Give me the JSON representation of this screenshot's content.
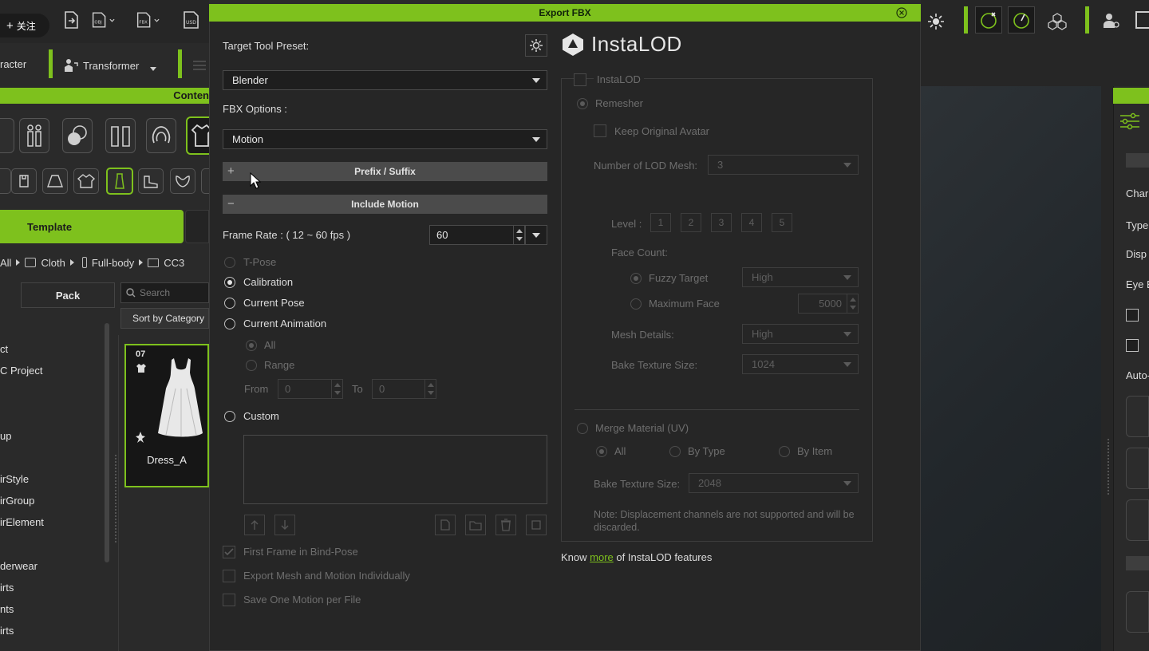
{
  "app": {
    "follow_label": "关注",
    "topbar_icons": [
      "import-icon",
      "obj-export-icon",
      "fbx-export-icon",
      "usd-export-icon"
    ],
    "character_label": "racter",
    "transformer_label": "Transformer",
    "content_label": "Conten",
    "template_tab": "Template",
    "breadcrumb": {
      "all": "All",
      "cloth": "Cloth",
      "fullbody": "Full-body",
      "cc3": "CC3"
    },
    "pack_tab": "Pack",
    "search_placeholder": "Search",
    "sort_label": "Sort by Category",
    "tree_items": [
      "ct",
      "C Project",
      "up",
      "irStyle",
      "irGroup",
      "irElement",
      "derwear",
      "irts",
      "nts",
      "irts"
    ],
    "thumbnail": {
      "badge": "07",
      "name": "Dress_A"
    },
    "right_panel_labels": [
      "Char",
      "Type",
      "Disp",
      "Eye E",
      "Auto-"
    ]
  },
  "dialog": {
    "title": "Export FBX",
    "target_tool_preset_label": "Target Tool Preset:",
    "target_tool_preset_value": "Blender",
    "fbx_options_label": "FBX Options :",
    "fbx_options_value": "Motion",
    "prefix_suffix": {
      "symbol": "+",
      "label": "Prefix / Suffix"
    },
    "include_motion": {
      "symbol": "−",
      "label": "Include Motion"
    },
    "frame_rate_label": "Frame Rate : ( 12 ~ 60 fps )",
    "frame_rate_value": "60",
    "pose_options": {
      "tpose": "T-Pose",
      "calibration": "Calibration",
      "current_pose": "Current Pose",
      "current_animation": "Current Animation",
      "all": "All",
      "range": "Range",
      "from_label": "From",
      "from_value": "0",
      "to_label": "To",
      "to_value": "0",
      "custom": "Custom"
    },
    "selected_pose": "Calibration",
    "checkboxes": {
      "first_frame_bind_pose": "First Frame in Bind-Pose",
      "export_mesh_motion": "Export Mesh and Motion Individually",
      "save_one_motion": "Save One Motion per File"
    },
    "instalod": {
      "logo_text": "InstaLOD",
      "group_label": "InstaLOD",
      "remesher": "Remesher",
      "keep_original": "Keep Original Avatar",
      "num_lod_label": "Number of LOD Mesh:",
      "num_lod_value": "3",
      "level_label": "Level :",
      "levels": [
        "1",
        "2",
        "3",
        "4",
        "5"
      ],
      "face_count_label": "Face Count:",
      "fuzzy_target": "Fuzzy Target",
      "fuzzy_value": "High",
      "maximum_face": "Maximum Face",
      "max_face_value": "5000",
      "mesh_details_label": "Mesh Details:",
      "mesh_details_value": "High",
      "bake_texture_label": "Bake Texture Size:",
      "bake_texture_value": "1024",
      "merge_material": "Merge Material (UV)",
      "merge_all": "All",
      "merge_by_type": "By Type",
      "merge_by_item": "By Item",
      "merge_bake_label": "Bake Texture Size:",
      "merge_bake_value": "2048",
      "note": "Note: Displacement channels are not supported and will be discarded.",
      "know_prefix": "Know",
      "know_link": "more",
      "know_suffix": "of InstaLOD features"
    }
  },
  "colors": {
    "accent": "#7ec11d",
    "dialog_bg": "#262626",
    "disabled_text": "#6e6e6e"
  }
}
